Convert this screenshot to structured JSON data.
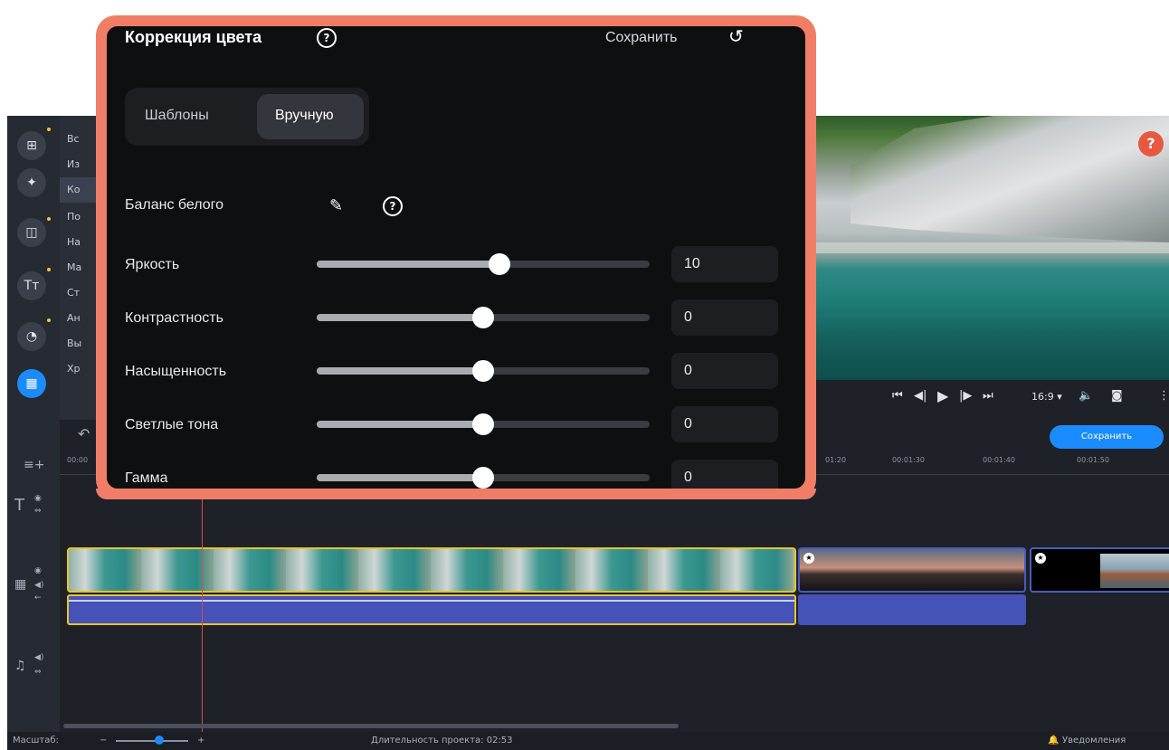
{
  "dialog": {
    "title": "Коррекция цвета",
    "save_label": "Сохранить",
    "reset_icon": "undo-icon",
    "help_icon": "question-circle-icon",
    "tabs": [
      {
        "label": "Шаблоны",
        "selected": false
      },
      {
        "label": "Вручную",
        "selected": true
      }
    ],
    "white_balance_label": "Баланс белого",
    "pipette_icon": "eyedropper-icon",
    "sliders": [
      {
        "label": "Яркость",
        "value": "10",
        "fraction": 0.55
      },
      {
        "label": "Контрастность",
        "value": "0",
        "fraction": 0.5
      },
      {
        "label": "Насыщенность",
        "value": "0",
        "fraction": 0.5
      },
      {
        "label": "Светлые тона",
        "value": "0",
        "fraction": 0.5
      },
      {
        "label": "Гамма",
        "value": "0",
        "fraction": 0.5
      }
    ],
    "frame_color": "#f07e66"
  },
  "sidebar": {
    "icons": [
      "import-icon",
      "magic-wand-icon",
      "transitions-icon",
      "titles-icon",
      "stickers-icon",
      "more-tools-icon"
    ],
    "active_index": 5,
    "list_items": [
      {
        "label": "Вс",
        "selected": false
      },
      {
        "label": "Из",
        "selected": false
      },
      {
        "label": "Ко",
        "selected": true
      },
      {
        "label": "По",
        "selected": false
      },
      {
        "label": "На",
        "selected": false
      },
      {
        "label": "Ма",
        "selected": false
      },
      {
        "label": "Ст",
        "selected": false
      },
      {
        "label": "Ан",
        "selected": false
      },
      {
        "label": "Вы",
        "selected": false
      },
      {
        "label": "Хр",
        "selected": false
      }
    ]
  },
  "player": {
    "aspect_ratio": "16:9",
    "help_badge": "?"
  },
  "timeline": {
    "save_button": "Сохранить",
    "ticks": [
      "00:00",
      "01:20",
      "00:01:30",
      "00:01:40",
      "00:01:50"
    ],
    "accent_color": "#1a8cff"
  },
  "status": {
    "zoom_label": "Масштаб:",
    "duration": "Длительность проекта: 02:53",
    "notifications": "Уведомления"
  }
}
